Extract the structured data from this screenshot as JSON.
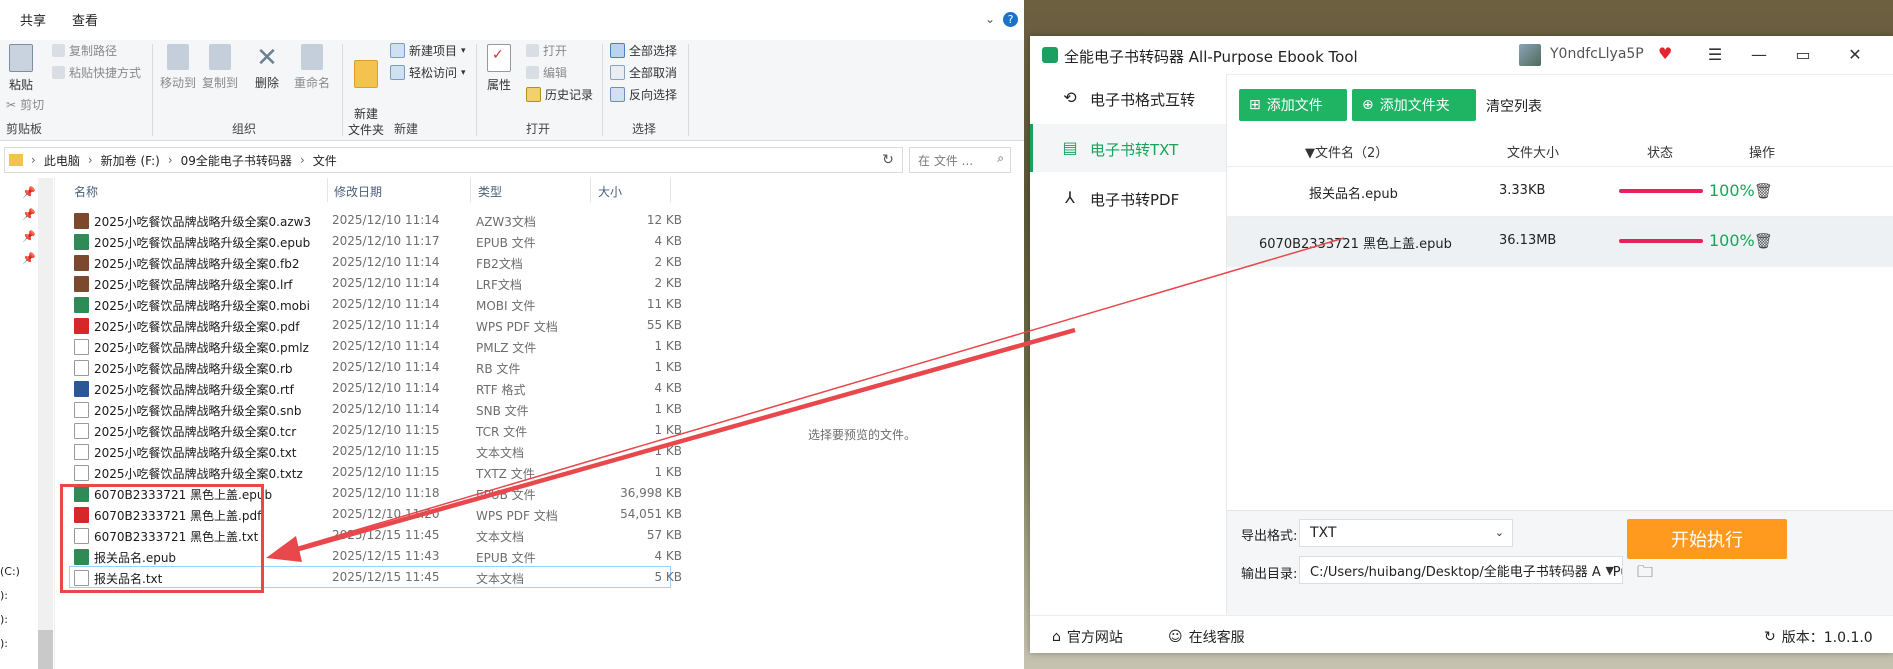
{
  "explorer": {
    "tabs": [
      "共享",
      "查看"
    ],
    "ribbon": {
      "clipboard": {
        "paste": "粘贴",
        "copy_path": "复制路径",
        "paste_shortcut": "粘贴快捷方式",
        "cut": "剪切",
        "group": "剪贴板"
      },
      "organize": {
        "move_to": "移动到",
        "copy_to": "复制到",
        "delete": "删除",
        "rename": "重命名",
        "group": "组织"
      },
      "new": {
        "new_folder": "新建\n文件夹",
        "new_item": "新建项目",
        "easy_access": "轻松访问",
        "group": "新建"
      },
      "open": {
        "properties": "属性",
        "open": "打开",
        "edit": "编辑",
        "history": "历史记录",
        "group": "打开"
      },
      "select": {
        "select_all": "全部选择",
        "select_none": "全部取消",
        "invert": "反向选择",
        "group": "选择"
      }
    },
    "address": [
      "此电脑",
      "新加卷 (F:)",
      "09全能电子书转码器",
      "文件"
    ],
    "search_placeholder": "在 文件 ...",
    "columns": {
      "name": "名称",
      "date": "修改日期",
      "type": "类型",
      "size": "大小"
    },
    "drives": [
      "(C:)",
      "):",
      "):",
      "):"
    ],
    "files": [
      {
        "name": "2025小吃餐饮品牌战略升级全案0.azw3",
        "date": "2025/12/10 11:14",
        "type": "AZW3文档",
        "size": "12 KB",
        "icon": "book"
      },
      {
        "name": "2025小吃餐饮品牌战略升级全案0.epub",
        "date": "2025/12/10 11:17",
        "type": "EPUB 文件",
        "size": "4 KB",
        "icon": "epub"
      },
      {
        "name": "2025小吃餐饮品牌战略升级全案0.fb2",
        "date": "2025/12/10 11:14",
        "type": "FB2文档",
        "size": "2 KB",
        "icon": "book"
      },
      {
        "name": "2025小吃餐饮品牌战略升级全案0.lrf",
        "date": "2025/12/10 11:14",
        "type": "LRF文档",
        "size": "2 KB",
        "icon": "book"
      },
      {
        "name": "2025小吃餐饮品牌战略升级全案0.mobi",
        "date": "2025/12/10 11:14",
        "type": "MOBI 文件",
        "size": "11 KB",
        "icon": "epub"
      },
      {
        "name": "2025小吃餐饮品牌战略升级全案0.pdf",
        "date": "2025/12/10 11:14",
        "type": "WPS PDF 文档",
        "size": "55 KB",
        "icon": "pdf"
      },
      {
        "name": "2025小吃餐饮品牌战略升级全案0.pmlz",
        "date": "2025/12/10 11:14",
        "type": "PMLZ 文件",
        "size": "1 KB",
        "icon": "doc"
      },
      {
        "name": "2025小吃餐饮品牌战略升级全案0.rb",
        "date": "2025/12/10 11:14",
        "type": "RB 文件",
        "size": "1 KB",
        "icon": "doc"
      },
      {
        "name": "2025小吃餐饮品牌战略升级全案0.rtf",
        "date": "2025/12/10 11:14",
        "type": "RTF 格式",
        "size": "4 KB",
        "icon": "word"
      },
      {
        "name": "2025小吃餐饮品牌战略升级全案0.snb",
        "date": "2025/12/10 11:14",
        "type": "SNB 文件",
        "size": "1 KB",
        "icon": "doc"
      },
      {
        "name": "2025小吃餐饮品牌战略升级全案0.tcr",
        "date": "2025/12/10 11:15",
        "type": "TCR 文件",
        "size": "1 KB",
        "icon": "doc"
      },
      {
        "name": "2025小吃餐饮品牌战略升级全案0.txt",
        "date": "2025/12/10 11:15",
        "type": "文本文档",
        "size": "1 KB",
        "icon": "txt"
      },
      {
        "name": "2025小吃餐饮品牌战略升级全案0.txtz",
        "date": "2025/12/10 11:15",
        "type": "TXTZ 文件",
        "size": "1 KB",
        "icon": "doc"
      },
      {
        "name": "6070B2333721 黑色上盖.epub",
        "date": "2025/12/10 11:18",
        "type": "EPUB 文件",
        "size": "36,998 KB",
        "icon": "epub"
      },
      {
        "name": "6070B2333721 黑色上盖.pdf",
        "date": "2025/12/10 11:20",
        "type": "WPS PDF 文档",
        "size": "54,051 KB",
        "icon": "pdf"
      },
      {
        "name": "6070B2333721 黑色上盖.txt",
        "date": "2025/12/15 11:45",
        "type": "文本文档",
        "size": "57 KB",
        "icon": "txt"
      },
      {
        "name": "报关品名.epub",
        "date": "2025/12/15 11:43",
        "type": "EPUB 文件",
        "size": "4 KB",
        "icon": "epub"
      },
      {
        "name": "报关品名.txt",
        "date": "2025/12/15 11:45",
        "type": "文本文档",
        "size": "5 KB",
        "icon": "txt"
      }
    ],
    "preview_hint": "选择要预览的文件。"
  },
  "ebook": {
    "title": "全能电子书转码器 All-Purpose Ebook Tool",
    "username": "Y0ndfcLlya5P",
    "sidebar": [
      {
        "label": "电子书格式互转",
        "icon": "convert-icon"
      },
      {
        "label": "电子书转TXT",
        "icon": "txt-icon"
      },
      {
        "label": "电子书转PDF",
        "icon": "pdf-icon"
      }
    ],
    "toolbar": {
      "add_file": "添加文件",
      "add_folder": "添加文件夹",
      "clear": "清空列表"
    },
    "table_headers": {
      "name": "文件名（2）",
      "size": "文件大小",
      "status": "状态",
      "action": "操作"
    },
    "rows": [
      {
        "name": "报关品名.epub",
        "size": "3.33KB",
        "progress": "100%"
      },
      {
        "name": "6070B2333721 黑色上盖.epub",
        "size": "36.13MB",
        "progress": "100%"
      }
    ],
    "export_label": "导出格式:",
    "export_value": "TXT",
    "output_label": "输出目录:",
    "output_value": "C:/Users/huibang/Desktop/全能电子书转码器 All-Pu",
    "start": "开始执行",
    "footer": {
      "site": "官方网站",
      "support": "在线客服",
      "version": "版本：1.0.1.0"
    },
    "colors": {
      "accent": "#1eb464",
      "progress": "#e8215a",
      "start": "#ff9a1f",
      "annotation": "#e8474b"
    }
  }
}
